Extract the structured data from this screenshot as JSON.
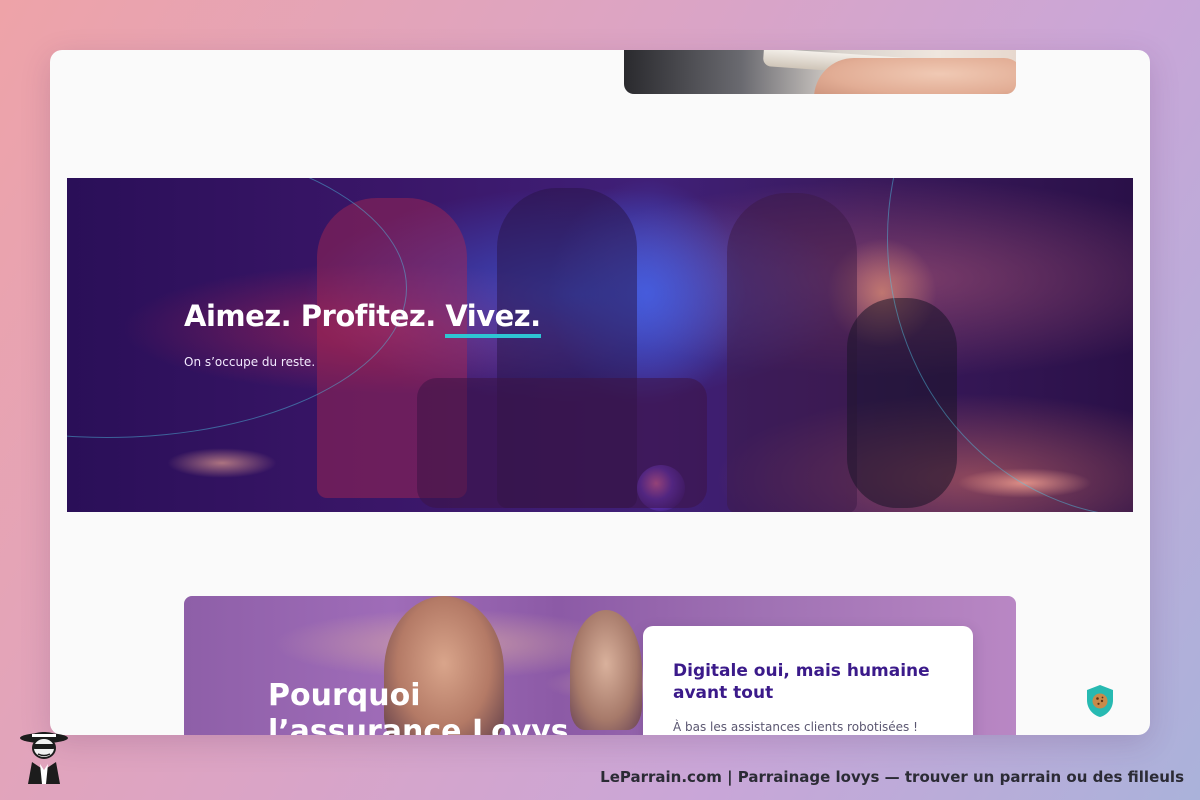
{
  "hero": {
    "title_part1": "Aimez. Profitez. ",
    "title_accent": "Vivez.",
    "subtitle": "On s’occupe du reste.",
    "accent_color": "#2ec5d3"
  },
  "why": {
    "title": "Pourquoi l’assurance Lovys",
    "card_title": "Digitale oui, mais humaine avant tout",
    "card_text": "À bas les assistances clients robotisées !"
  },
  "cookie": {
    "icon": "cookie-shield-icon"
  },
  "footer": {
    "caption": "LeParrain.com | Parrainage lovys — trouver un parrain ou des filleuls",
    "logo_icon": "spy-mascot-icon"
  },
  "colors": {
    "brand_purple": "#3b1a8a",
    "cookie_teal": "#27b9b1"
  }
}
